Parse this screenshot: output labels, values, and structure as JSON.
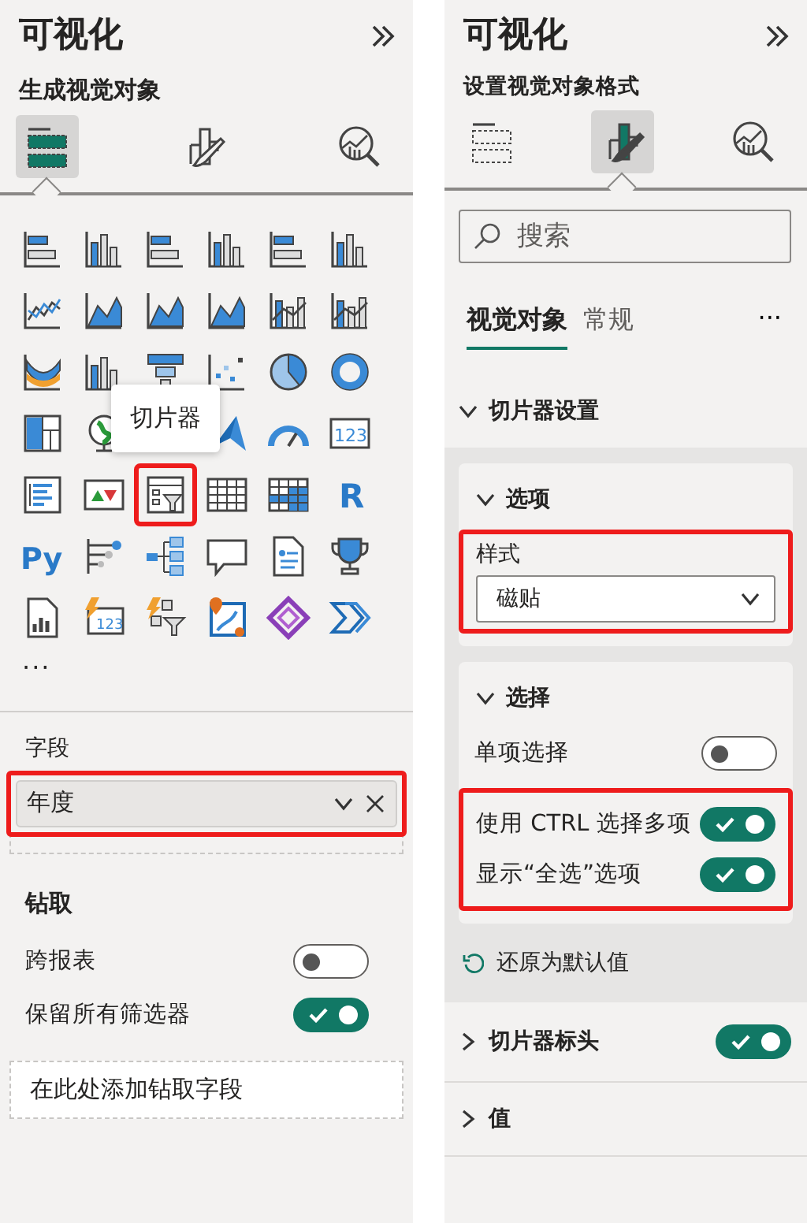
{
  "left": {
    "title": "可视化",
    "subtitle": "生成视觉对象",
    "view_tabs": [
      {
        "kind": "build",
        "selected": true
      },
      {
        "kind": "format",
        "selected": false
      },
      {
        "kind": "analytics",
        "selected": false
      }
    ],
    "gallery": {
      "tooltip": "切片器",
      "more": "···",
      "items": [
        {
          "kind": "hbar",
          "annotated": false
        },
        {
          "kind": "column",
          "annotated": false
        },
        {
          "kind": "hbar",
          "annotated": false
        },
        {
          "kind": "column",
          "annotated": false
        },
        {
          "kind": "hbar",
          "annotated": false
        },
        {
          "kind": "column",
          "annotated": false
        },
        {
          "kind": "line",
          "annotated": false
        },
        {
          "kind": "area",
          "annotated": false
        },
        {
          "kind": "area",
          "annotated": false
        },
        {
          "kind": "area",
          "annotated": false
        },
        {
          "kind": "combo",
          "annotated": false
        },
        {
          "kind": "combo",
          "annotated": false
        },
        {
          "kind": "ribbon",
          "annotated": false
        },
        {
          "kind": "column",
          "annotated": false
        },
        {
          "kind": "funnel",
          "annotated": false
        },
        {
          "kind": "scatter",
          "annotated": false
        },
        {
          "kind": "pie",
          "annotated": false
        },
        {
          "kind": "donut",
          "annotated": false
        },
        {
          "kind": "treemap",
          "annotated": false
        },
        {
          "kind": "globe",
          "annotated": false
        },
        {
          "kind": "covered"
        },
        {
          "kind": "pointer",
          "annotated": false
        },
        {
          "kind": "gauge",
          "annotated": false
        },
        {
          "kind": "card",
          "label": "123",
          "annotated": false
        },
        {
          "kind": "multirow",
          "annotated": false
        },
        {
          "kind": "kpi",
          "annotated": false
        },
        {
          "kind": "slicer",
          "annotated": true
        },
        {
          "kind": "table",
          "annotated": false
        },
        {
          "kind": "matrix",
          "annotated": false
        },
        {
          "kind": "letter",
          "label": "R",
          "annotated": false
        },
        {
          "kind": "letter",
          "label": "Py",
          "annotated": false
        },
        {
          "kind": "influencers",
          "annotated": false
        },
        {
          "kind": "tree",
          "annotated": false
        },
        {
          "kind": "bubble",
          "annotated": false
        },
        {
          "kind": "doc",
          "annotated": false
        },
        {
          "kind": "trophy",
          "annotated": false
        },
        {
          "kind": "report",
          "annotated": false
        },
        {
          "kind": "boltcard",
          "label": "123",
          "annotated": false
        },
        {
          "kind": "boltslicer",
          "annotated": false
        },
        {
          "kind": "mappin",
          "annotated": false
        },
        {
          "kind": "diamond",
          "annotated": false
        },
        {
          "kind": "chevrons",
          "annotated": false
        }
      ]
    },
    "fields": {
      "label": "字段",
      "wells": [
        {
          "value": "年度",
          "annotated": true
        }
      ]
    },
    "drillthrough": {
      "title": "钻取",
      "toggles": [
        {
          "label": "跨报表",
          "on": false
        },
        {
          "label": "保留所有筛选器",
          "on": true
        }
      ],
      "drop_placeholder": "在此处添加钻取字段"
    }
  },
  "right": {
    "title": "可视化",
    "subtitle": "设置视觉对象格式",
    "view_tabs": [
      {
        "kind": "build",
        "selected": false
      },
      {
        "kind": "format",
        "selected": true
      },
      {
        "kind": "analytics",
        "selected": false
      }
    ],
    "search": {
      "placeholder": "搜索"
    },
    "tabs": [
      {
        "label": "视觉对象",
        "selected": true
      },
      {
        "label": "常规",
        "selected": false
      }
    ],
    "more": "···",
    "sections": [
      {
        "title": "切片器设置",
        "expanded": true,
        "reset": "还原为默认值",
        "cards": [
          {
            "kind": "dropdown",
            "title": "选项",
            "label": "样式",
            "value": "磁贴",
            "annotated": true
          },
          {
            "kind": "toggles",
            "title": "选择",
            "items": [
              {
                "label": "单项选择",
                "on": false,
                "annotated": false
              },
              {
                "label": "使用 CTRL 选择多项",
                "on": true,
                "annotated": true
              },
              {
                "label": "显示“全选”选项",
                "on": true,
                "annotated": true
              }
            ]
          }
        ]
      },
      {
        "title": "切片器标头",
        "expanded": false,
        "toggle": true
      },
      {
        "title": "值",
        "expanded": false
      }
    ]
  }
}
